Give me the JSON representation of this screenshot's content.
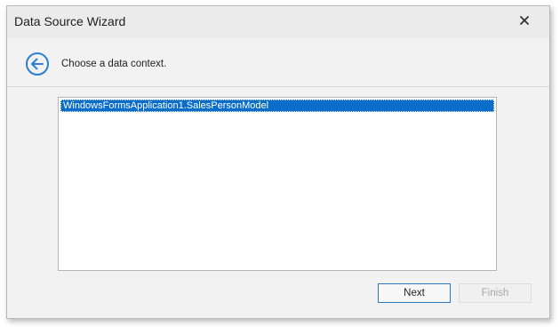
{
  "window": {
    "title": "Data Source Wizard"
  },
  "icons": {
    "close": "close-icon",
    "back": "back-arrow-icon"
  },
  "header": {
    "text": "Choose a data context."
  },
  "list": {
    "items": [
      {
        "label": "WindowsFormsApplication1.SalesPersonModel",
        "selected": true
      }
    ]
  },
  "footer": {
    "next_label": "Next",
    "finish_label": "Finish",
    "finish_enabled": false
  },
  "colors": {
    "accent": "#0a6dca",
    "back_icon": "#2b7fd4",
    "window_bg": "#f2f2f2"
  }
}
